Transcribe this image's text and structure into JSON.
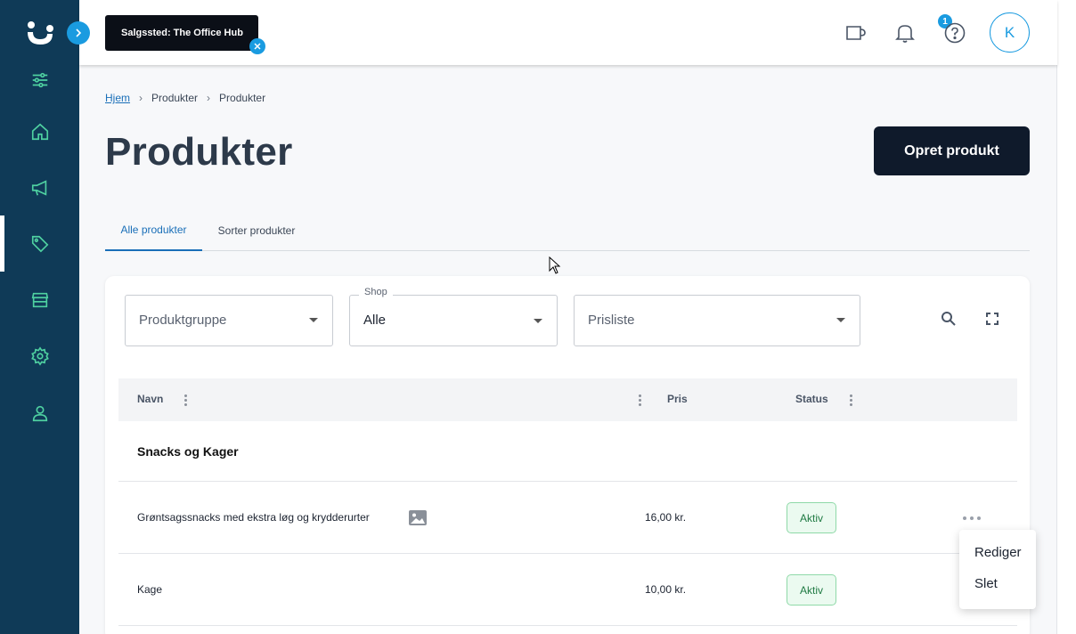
{
  "topbar": {
    "store_label": "Salgssted: The Office Hub",
    "cart_badge": "1",
    "avatar_initial": "K"
  },
  "breadcrumb": [
    "Hjem",
    "Produkter",
    "Produkter"
  ],
  "page": {
    "title": "Produkter",
    "create_button": "Opret produkt"
  },
  "tabs": [
    "Alle produkter",
    "Sorter produkter"
  ],
  "filters": {
    "product_group_placeholder": "Produktgruppe",
    "shop_label": "Shop",
    "shop_value": "Alle",
    "pricelist_placeholder": "Prisliste"
  },
  "table": {
    "headers": {
      "name": "Navn",
      "price": "Pris",
      "status": "Status"
    },
    "group_name": "Snacks og Kager",
    "rows": [
      {
        "name": "Grøntsagssnacks med ekstra løg og krydderurter",
        "price": "16,00 kr.",
        "status": "Aktiv",
        "has_image_icon": true
      },
      {
        "name": "Kage",
        "price": "10,00 kr.",
        "status": "Aktiv",
        "has_image_icon": false
      }
    ]
  },
  "row_menu": [
    "Rediger",
    "Slet"
  ],
  "colors": {
    "sidebar": "#0f3a57",
    "accent": "#1a9be0",
    "nav_icon": "#4fd1a1",
    "primary_button": "#0f1a2b",
    "status_green": "#1f7a43"
  },
  "icons": {
    "sidebar": [
      "sliders-icon",
      "home-icon",
      "megaphone-icon",
      "tag-icon",
      "store-icon",
      "gear-icon",
      "user-icon"
    ],
    "topbar": [
      "cart-icon",
      "bell-icon",
      "help-icon"
    ]
  }
}
